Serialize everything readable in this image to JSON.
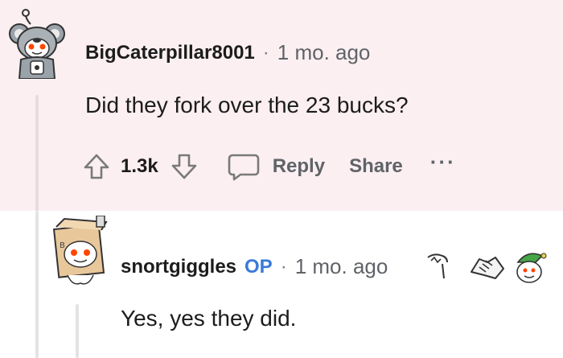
{
  "comment1": {
    "username": "BigCaterpillar8001",
    "separator": "·",
    "age": "1 mo. ago",
    "body": "Did they fork over the 23 bucks?",
    "score": "1.3k",
    "reply_label": "Reply",
    "share_label": "Share",
    "more_label": "···",
    "icons": [
      "koala-avatar-icon",
      "upvote-icon",
      "downvote-icon",
      "comment-bubble-icon"
    ]
  },
  "comment2": {
    "username": "snortgiggles",
    "op_badge": "OP",
    "separator": "·",
    "age": "1 mo. ago",
    "body": "Yes, yes they did.",
    "icons": [
      "box-robot-avatar-icon",
      "wholesome-award-icon",
      "handshake-award-icon",
      "elf-hat-award-icon"
    ]
  },
  "colors": {
    "highlight_bg": "#fbeff1",
    "op_blue": "#3a7ad8",
    "muted": "#5f6368"
  }
}
